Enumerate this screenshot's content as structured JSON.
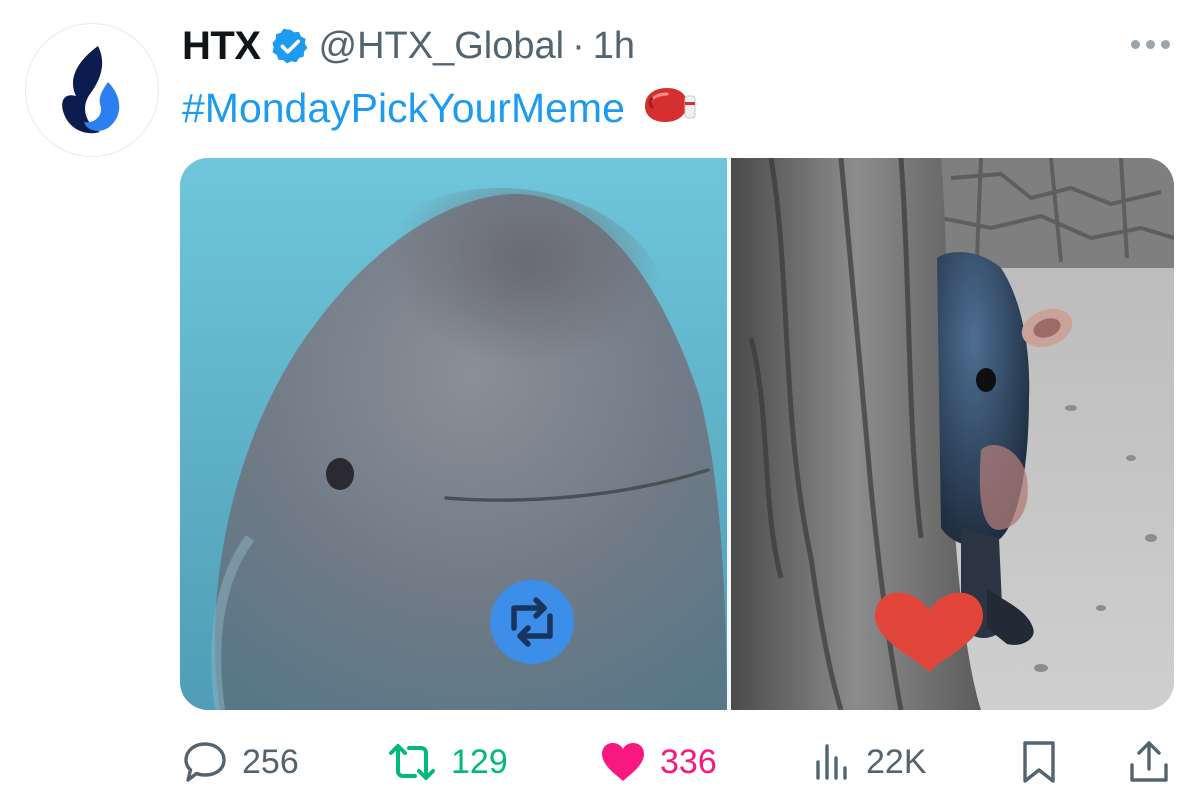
{
  "author": {
    "display_name": "HTX",
    "handle": "@HTX_Global",
    "separator": "·",
    "time": "1h",
    "verified": true,
    "avatar_icon": "htx-flame-logo-icon"
  },
  "tweet": {
    "hashtag": "#MondayPickYourMeme",
    "emoji_icon": "boxing-glove-icon"
  },
  "media": {
    "images": [
      {
        "name": "beluga-whale-photo",
        "overlay_icon": "repost-icon"
      },
      {
        "name": "pygmy-hippo-photo",
        "overlay_icon": "heart-icon"
      }
    ]
  },
  "actions": {
    "reply": {
      "icon": "reply-icon",
      "count": "256"
    },
    "repost": {
      "icon": "repost-icon",
      "count": "129"
    },
    "like": {
      "icon": "heart-icon",
      "count": "336"
    },
    "views": {
      "icon": "views-chart-icon",
      "count": "22K"
    },
    "bookmark": {
      "icon": "bookmark-icon"
    },
    "share": {
      "icon": "share-icon"
    }
  },
  "colors": {
    "link": "#1d9bf0",
    "muted": "#536471",
    "repost": "#00ba7c",
    "like": "#f91880",
    "brand_dark": "#0d1c4f",
    "brand_blue": "#2b7ff0"
  }
}
